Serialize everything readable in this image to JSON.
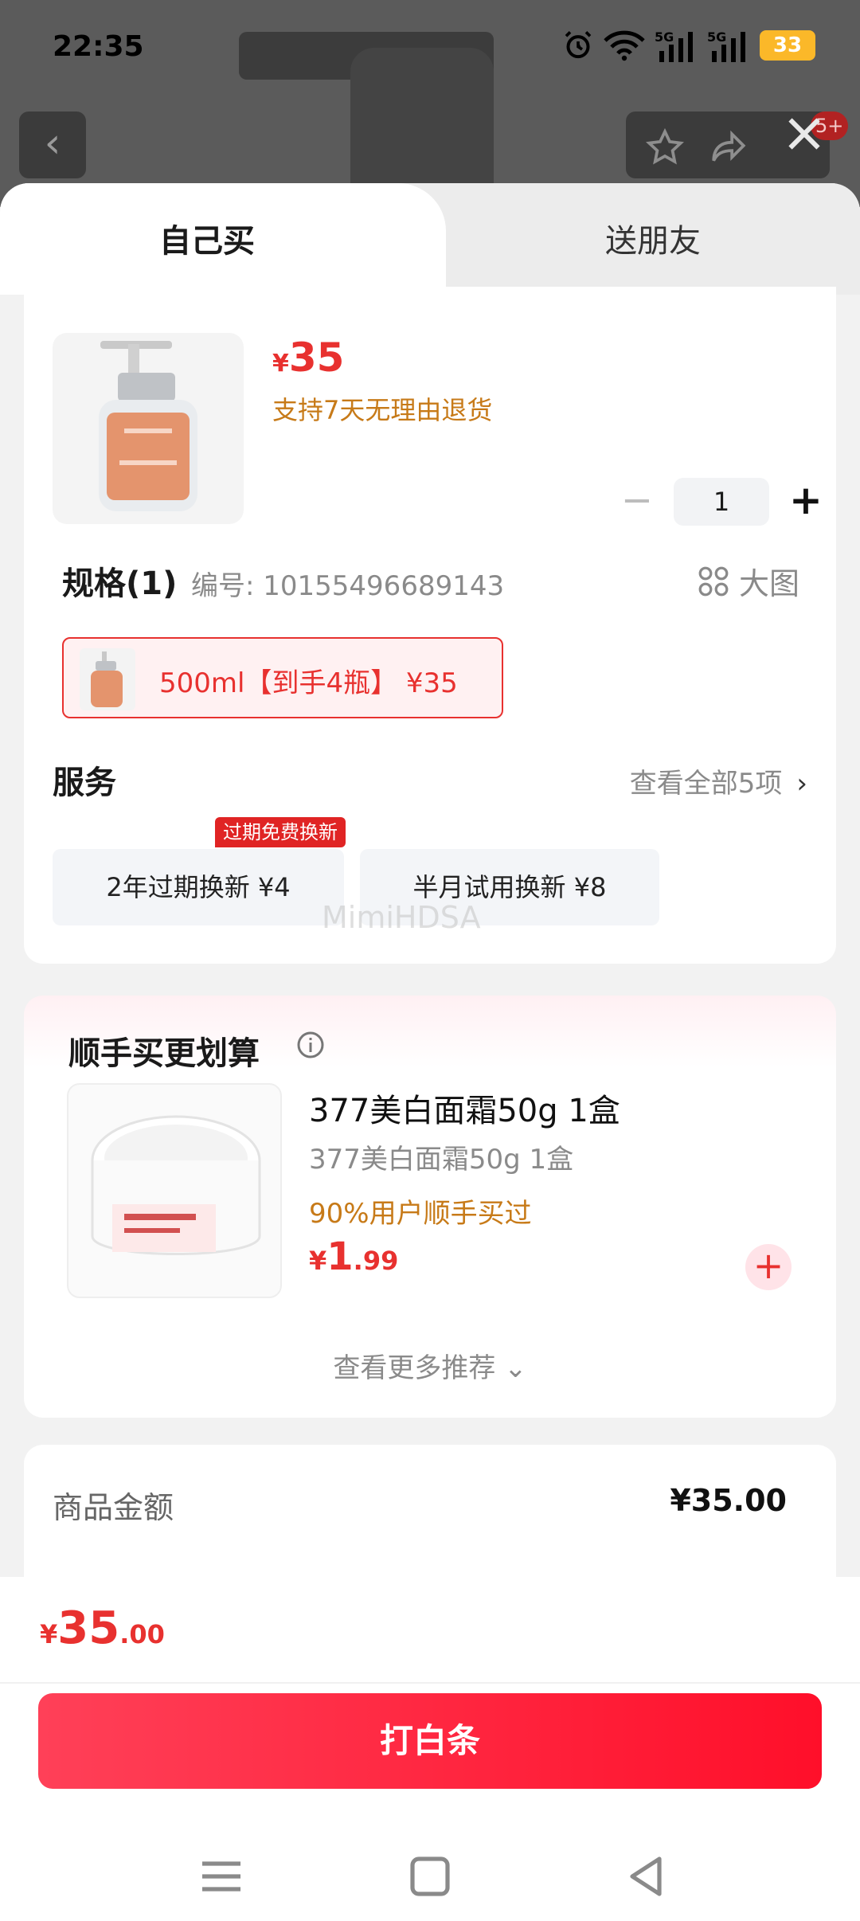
{
  "status": {
    "time": "22:35",
    "battery": "33",
    "net1": "5G",
    "net2": "5G"
  },
  "background": {
    "badge": "5+"
  },
  "tabs": {
    "self": "自己买",
    "gift": "送朋友"
  },
  "product": {
    "currency": "¥",
    "price": "35",
    "return_note": "支持7天无理由退货",
    "quantity": "1"
  },
  "spec": {
    "title": "规格(1)",
    "code": "编号: 10155496689143",
    "big_picture": "大图",
    "selected_option": "500ml【到手4瓶】 ¥35"
  },
  "service": {
    "title": "服务",
    "view_all": "查看全部5项",
    "tag": "过期免费换新",
    "options": [
      "2年过期换新  ¥4",
      "半月试用换新  ¥8"
    ]
  },
  "watermark": "MimiHDSA",
  "recommend": {
    "title": "顺手买更划算",
    "item_name": "377美白面霜50g 1盒",
    "item_sub": "377美白面霜50g 1盒",
    "social_proof": "90%用户顺手买过",
    "currency": "¥",
    "price_int": "1",
    "price_dec": ".99",
    "more": "查看更多推荐 ⌄"
  },
  "amount": {
    "label": "商品金额",
    "value": "¥35.00"
  },
  "footer": {
    "currency": "¥",
    "total_int": "35",
    "total_dec": ".00",
    "pay_label": "打白条"
  },
  "colors": {
    "accent": "#e8312f",
    "orange_text": "#c77a18",
    "pay_button": "#ff1f3a"
  }
}
